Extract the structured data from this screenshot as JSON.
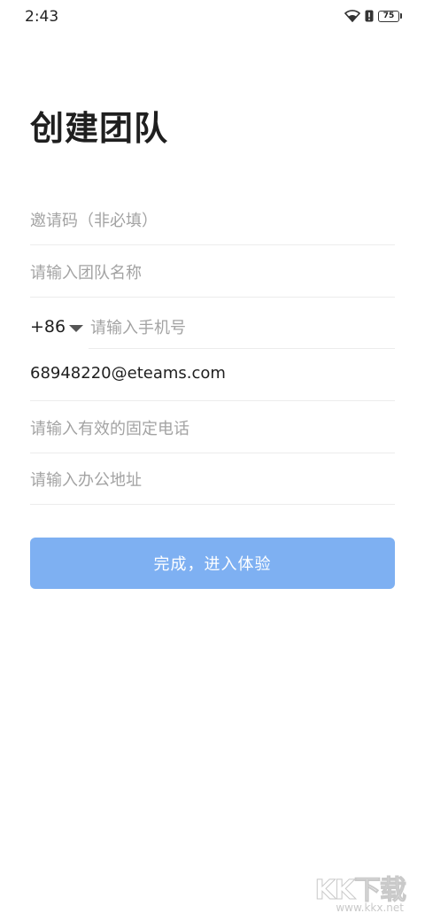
{
  "status_bar": {
    "time": "2:43",
    "battery_level": "75",
    "icons": [
      "wifi-icon",
      "alert-icon",
      "battery-icon"
    ]
  },
  "page": {
    "title": "创建团队"
  },
  "form": {
    "invite_code": {
      "placeholder": "邀请码（非必填）",
      "value": ""
    },
    "team_name": {
      "placeholder": "请输入团队名称",
      "value": ""
    },
    "country_code": "+86",
    "phone": {
      "placeholder": "请输入手机号",
      "value": ""
    },
    "email": {
      "placeholder": "",
      "value": "68948220@eteams.com"
    },
    "landline": {
      "placeholder": "请输入有效的固定电话",
      "value": ""
    },
    "address": {
      "placeholder": "请输入办公地址",
      "value": ""
    }
  },
  "submit_label": "完成，进入体验",
  "colors": {
    "primary_button": "#7eb0f2",
    "placeholder_text": "#a3a3a3",
    "divider": "#ececec"
  },
  "watermark": {
    "logo": "KK下载",
    "url": "www.kkx.net"
  }
}
